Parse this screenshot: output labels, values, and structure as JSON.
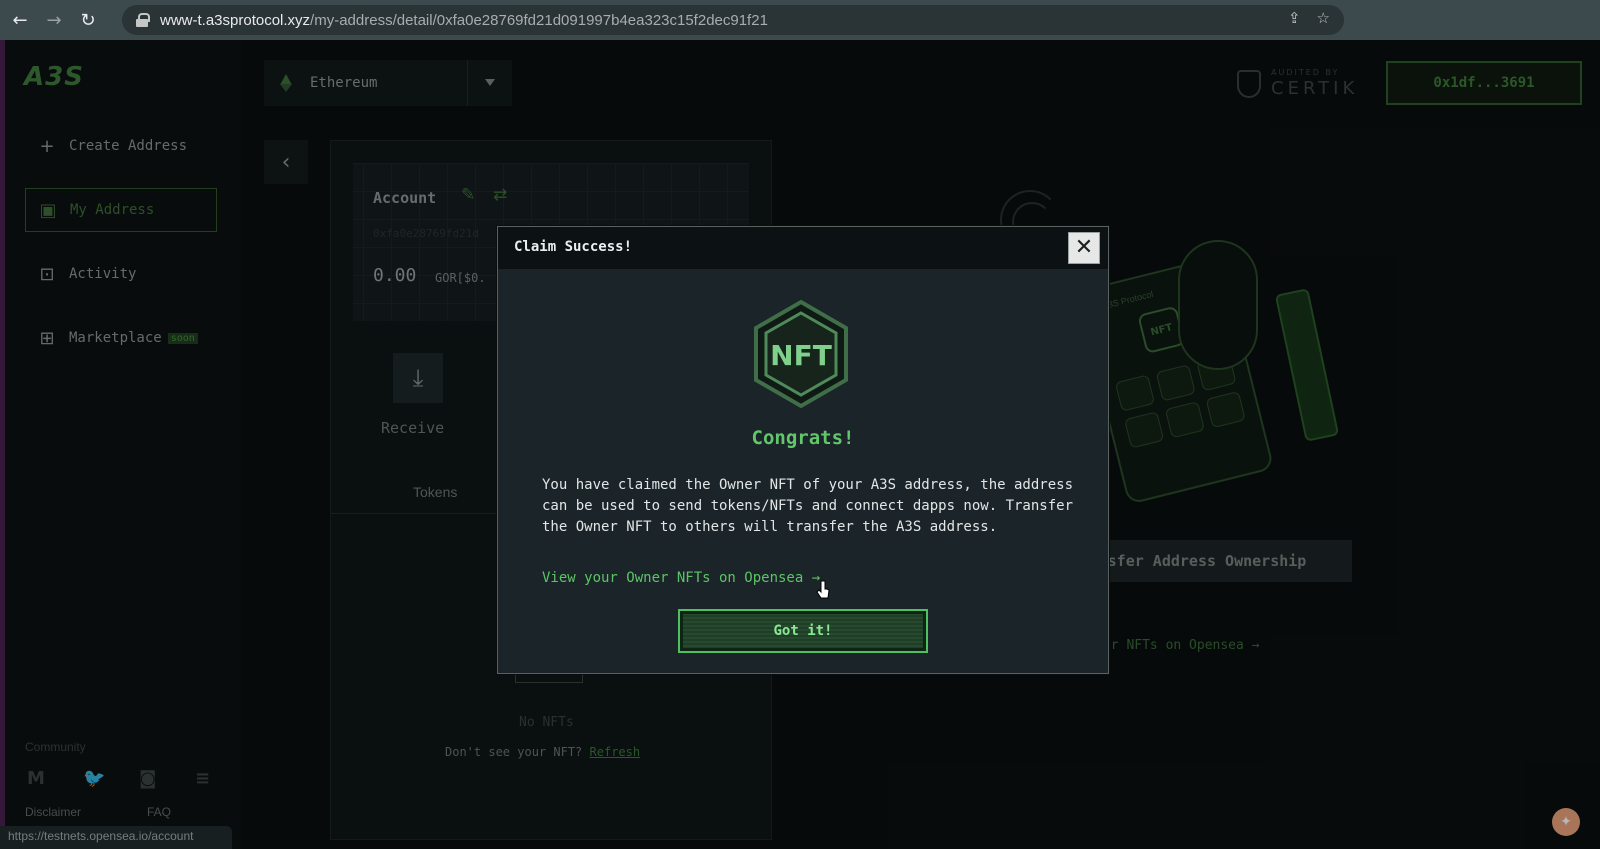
{
  "browser": {
    "back_glyph": "←",
    "forward_glyph": "→",
    "reload_glyph": "↻",
    "url_host": "www-t.a3sprotocol.xyz",
    "url_path": "/my-address/detail/0xfa0e28769fd21d091997b4ea323c15f2dec91f21",
    "share_glyph": "⇪",
    "star_glyph": "☆",
    "status_url": "https://testnets.opensea.io/account"
  },
  "sidebar": {
    "logo": "A3S",
    "items": [
      {
        "label": "Create Address",
        "icon": "plus-icon",
        "glyph": "+"
      },
      {
        "label": "My Address",
        "icon": "wallet-icon",
        "glyph": "▣"
      },
      {
        "label": "Activity",
        "icon": "basket-icon",
        "glyph": "⊡"
      },
      {
        "label": "Marketplace",
        "icon": "store-icon",
        "glyph": "⊞",
        "badge": "soon"
      }
    ],
    "community_label": "Community",
    "social": [
      {
        "icon": "medium-icon",
        "glyph": "M"
      },
      {
        "icon": "twitter-icon",
        "glyph": "🐦"
      },
      {
        "icon": "discord-icon",
        "glyph": "◙"
      },
      {
        "icon": "docs-icon",
        "glyph": "≡"
      }
    ],
    "disclaimer": "Disclaimer",
    "faq": "FAQ"
  },
  "topbar": {
    "chain": "Ethereum",
    "audited_by": "AUDITED BY",
    "auditor": "CERTIK",
    "wallet": "0x1df...3691"
  },
  "account": {
    "title": "Account",
    "address": "0xfa0e28769fd21d",
    "balance": "0.00",
    "unit": "GOR[$0.",
    "receive": "Receive",
    "tokens_tab": "Tokens",
    "no_nfts": "No NFTs",
    "dont_see": "Don't see your NFT?",
    "refresh": "Refresh"
  },
  "background": {
    "phone_label": "A3S Protocol",
    "nft_badge": "NFT",
    "transfer_label": "sfer Address Ownership",
    "opensea_link": "ur Owner NFTs on Opensea →"
  },
  "modal": {
    "title": "Claim Success!",
    "close_glyph": "✕",
    "nft_text": "NFT",
    "congrats": "Congrats!",
    "body": "You have claimed the Owner NFT of your A3S address, the address can be used to send tokens/NFTs and connect dapps now. Transfer the Owner NFT to others will transfer the A3S address.",
    "link": "View your Owner NFTs on Opensea →",
    "button": "Got it!"
  },
  "colors": {
    "accent_green": "#5cc466",
    "modal_bg": "#1b2429",
    "page_bg": "#0b0f10"
  }
}
